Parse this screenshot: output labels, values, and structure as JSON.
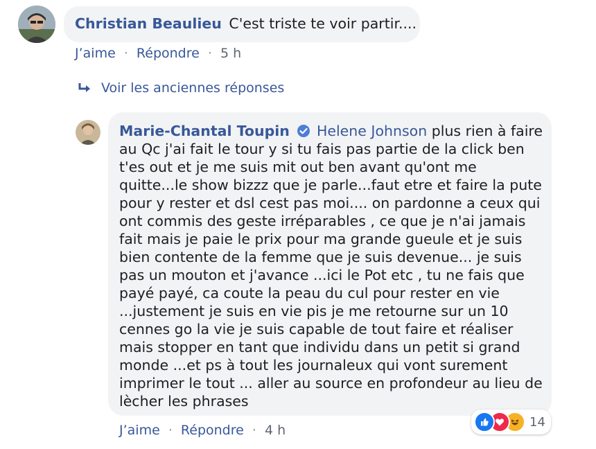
{
  "comment1": {
    "author": "Christian Beaulieu",
    "text": "C'est triste te voir partir....",
    "like_label": "J’aime",
    "reply_label": "Répondre",
    "time": "5 h"
  },
  "view_older_replies": "Voir les anciennes réponses",
  "comment2": {
    "author": "Marie-Chantal Toupin",
    "verified": true,
    "mention": "Helene Johnson",
    "text": "plus rien à faire au Qc j'ai fait le tour y si tu fais pas partie de la click ben t'es out et je me suis mit out ben avant qu'ont me quitte...le show bizzz que je parle...faut etre et faire la pute pour y rester et dsl cest pas moi.... on pardonne a ceux qui ont commis des geste irréparables , ce que je n'ai jamais fait mais je paie le prix pour ma grande gueule et je suis bien contente de la femme que je suis devenue... je suis pas un mouton et j'avance ...ici le Pot etc , tu ne fais que payé payé, ca coute la peau du cul pour rester en vie ...justement je suis en vie pis je me retourne sur un 10 cennes go la vie je suis capable de tout faire et réaliser mais stopper en tant que individu dans un petit si grand monde ...et ps à tout les journaleux qui vont surement imprimer le tout ... aller au source en profondeur au lieu de lècher les phrases",
    "like_label": "J’aime",
    "reply_label": "Répondre",
    "time": "4 h",
    "reactions": {
      "icons": [
        "like-icon",
        "love-icon",
        "haha-icon"
      ],
      "count": "14"
    }
  }
}
